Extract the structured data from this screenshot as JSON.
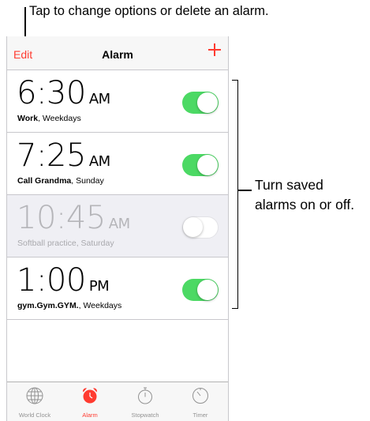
{
  "callouts": {
    "top": "Tap to change options or delete an alarm.",
    "right_line1": "Turn saved",
    "right_line2": "alarms on or off."
  },
  "navbar": {
    "edit_label": "Edit",
    "title": "Alarm",
    "add_icon": "plus-icon"
  },
  "alarms": [
    {
      "time": "6:30",
      "ampm": "AM",
      "name": "Work",
      "repeat": ", Weekdays",
      "enabled": true
    },
    {
      "time": "7:25",
      "ampm": "AM",
      "name": "Call Grandma",
      "repeat": ", Sunday",
      "enabled": true
    },
    {
      "time": "10:45",
      "ampm": "AM",
      "name": "Softball practice",
      "repeat": ", Saturday",
      "enabled": false
    },
    {
      "time": "1:00",
      "ampm": "PM",
      "name": "gym.Gym.GYM.",
      "repeat": ", Weekdays",
      "enabled": true
    }
  ],
  "tabs": [
    {
      "label": "World Clock",
      "icon": "globe-icon",
      "active": false
    },
    {
      "label": "Alarm",
      "icon": "alarm-clock-icon",
      "active": true
    },
    {
      "label": "Stopwatch",
      "icon": "stopwatch-icon",
      "active": false
    },
    {
      "label": "Timer",
      "icon": "timer-icon",
      "active": false
    }
  ],
  "colors": {
    "accent": "#ff3b30",
    "toggle_on": "#4cd964",
    "disabled_row": "#efeff4"
  }
}
